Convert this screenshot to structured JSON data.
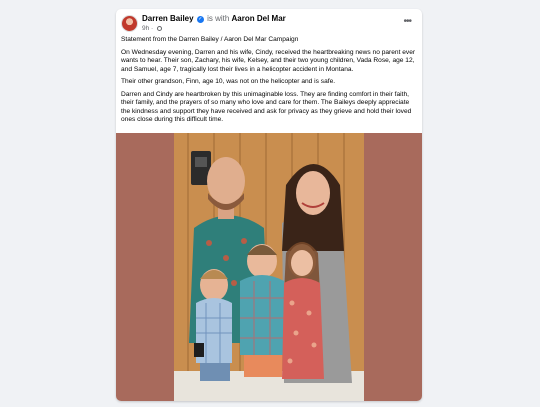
{
  "post": {
    "author": "Darren Bailey",
    "with_text": "is with",
    "tagged_user": "Aaron Del Mar",
    "timestamp": "9h",
    "more_icon": "more-horizontal-icon",
    "verified_icon": "verified-badge-icon",
    "audience_icon": "globe-icon",
    "paragraphs": [
      "Statement from the Darren Bailey / Aaron Del Mar Campaign",
      "On Wednesday evening, Darren and his wife, Cindy, received the heartbreaking news no parent ever wants to hear. Their son, Zachary, his wife, Kelsey, and their two young children, Vada Rose, age 12, and Samuel, age 7, tragically lost their lives in a helicopter accident in Montana.",
      "Their other grandson, Finn, age 10, was not on the helicopter and is safe.",
      "Darren and Cindy are heartbroken by this unimaginable loss. They are finding comfort in their faith, their family, and the prayers of so many who love and care for them. The Baileys deeply appreciate the kindness and support they have received and ask for privacy as they grieve and hold their loved ones close during this difficult time."
    ]
  },
  "colors": {
    "page_bg": "#f0f2f5",
    "photo_frame": "#a86a5c",
    "verified_blue": "#1877f2"
  }
}
